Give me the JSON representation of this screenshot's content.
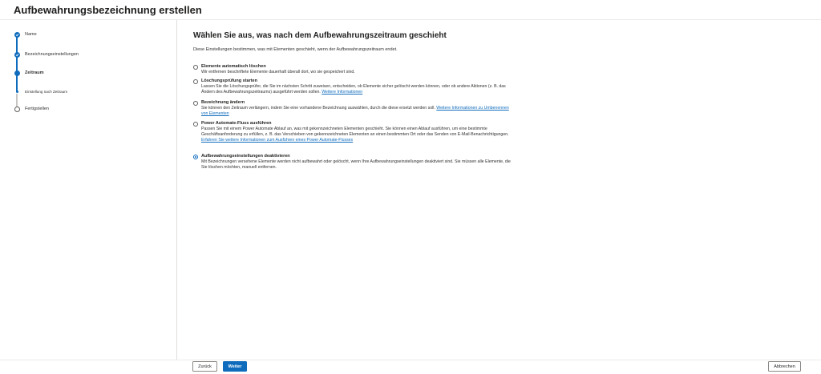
{
  "header": {
    "title": "Aufbewahrungsbezeichnung erstellen"
  },
  "steps": [
    {
      "label": "Name",
      "state": "done"
    },
    {
      "label": "Bezeichnungseinstellungen",
      "state": "done"
    },
    {
      "label": "Zeitraum",
      "state": "current"
    },
    {
      "label": "Einstellung nach Zeitraum",
      "state": "current-sub"
    },
    {
      "label": "Fertigstellen",
      "state": "pending"
    }
  ],
  "main": {
    "heading": "Wählen Sie aus, was nach dem Aufbewahrungszeitraum geschieht",
    "intro": "Diese Einstellungen bestimmen, was mit Elementen geschieht, wenn der Aufbewahrungszeitraum endet.",
    "options": [
      {
        "title": "Elemente automatisch löschen",
        "desc": "Wir entfernen beschriftete Elemente dauerhaft überall dort, wo sie gespeichert sind.",
        "link": "",
        "link_after": "",
        "checked": false
      },
      {
        "title": "Löschungsprüfung starten",
        "desc": "Lassen Sie die Löschungsprüfer, die Sie im nächsten Schritt zuweisen, entscheiden, ob Elemente sicher gelöscht werden können, oder ob andere Aktionen (z. B. das Ändern des Aufbewahrungszeitraums) ausgeführt werden sollen.",
        "link": "Weitere Informationen",
        "link_after": "",
        "checked": false
      },
      {
        "title": "Bezeichnung ändern",
        "desc": "Sie können den Zeitraum verlängern, indem Sie eine vorhandene Bezeichnung auswählen, durch die diese ersetzt werden soll.",
        "link": "Weitere Informationen zu Umbenennen von Elementen",
        "link_after": "",
        "checked": false
      },
      {
        "title": "Power Automate-Fluss ausführen",
        "desc": "Passen Sie mit einem Power Automate Ablauf an, was mit gekennzeichneten Elementen geschieht. Sie können einen Ablauf ausführen, um eine bestimmte Geschäftsanforderung zu erfüllen, z. B. das Verschieben von gekennzeichneten Elementen an einen bestimmten Ort oder das Senden von E-Mail-Benachrichtigungen.",
        "link": "Erfahren Sie weitere Informationen zum Ausführen eines Power Automate-Flusses",
        "link_after": "",
        "checked": false
      },
      {
        "title": "Aufbewahrungseinstellungen deaktivieren",
        "desc": "Mit Bezeichnungen versehene Elemente werden nicht aufbewahrt oder gelöscht, wenn Ihre Aufbewahrungseinstellungen deaktiviert sind. Sie müssen alle Elemente, die Sie löschen möchten, manuell entfernen.",
        "link": "",
        "link_after": "",
        "checked": true
      }
    ]
  },
  "footer": {
    "back_label": "Zurück",
    "next_label": "Weiter",
    "cancel_label": "Abbrechen"
  },
  "colors": {
    "accent": "#0f6cbd",
    "link": "#0f6cbd",
    "text": "#201f1e"
  },
  "icons": {
    "done": "checkmark-icon"
  }
}
